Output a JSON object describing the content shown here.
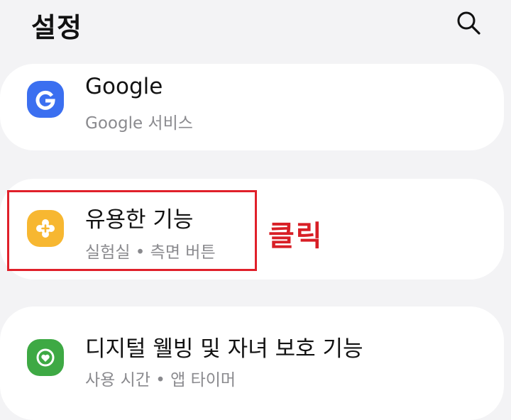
{
  "header": {
    "title": "설정"
  },
  "items": [
    {
      "title": "Google",
      "subtitle": "Google 서비스",
      "icon": "google-icon",
      "icon_color": "#3b6ff0"
    },
    {
      "title": "유용한 기능",
      "subtitle": "실험실 • 측면 버튼",
      "icon": "puzzle-plus-icon",
      "icon_color": "#f7b731"
    },
    {
      "title": "디지털 웰빙 및 자녀 보호 기능",
      "subtitle": "사용 시간 • 앱 타이머",
      "icon": "wellbeing-heart-icon",
      "icon_color": "#3ea944"
    }
  ],
  "annotation": {
    "label": "클릭",
    "color": "#d81f26"
  }
}
